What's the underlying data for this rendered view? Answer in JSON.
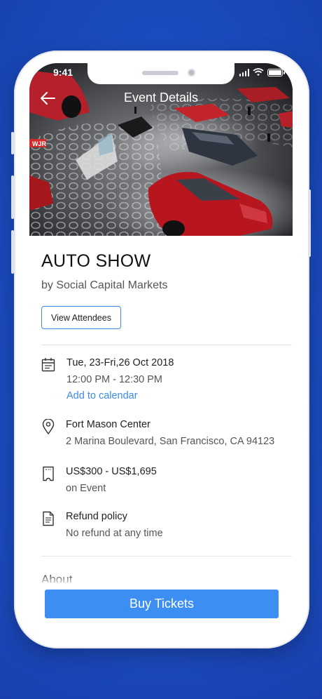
{
  "status_bar": {
    "time": "9:41"
  },
  "nav": {
    "title": "Event Details",
    "back_icon": "arrow-left-icon"
  },
  "colors": {
    "accent": "#3d8ef2",
    "link": "#3d8ae8",
    "background": "#1d4fc4"
  },
  "event": {
    "title": "AUTO SHOW",
    "organizer": "by Social Capital Markets",
    "view_attendees_label": "View Attendees"
  },
  "details": {
    "date": {
      "icon": "calendar-icon",
      "date_text": "Tue, 23-Fri,26 Oct 2018",
      "time_text": "12:00 PM - 12:30 PM",
      "add_calendar_label": "Add to calendar"
    },
    "location": {
      "icon": "map-pin-icon",
      "venue": "Fort Mason Center",
      "address": "2 Marina Boulevard, San Francisco, CA 94123"
    },
    "price": {
      "icon": "ticket-icon",
      "range": "US$300 - US$1,695",
      "note": "on Event"
    },
    "refund": {
      "icon": "document-icon",
      "title": "Refund policy",
      "text": "No refund at any time"
    }
  },
  "about": {
    "heading": "About"
  },
  "footer": {
    "buy_label": "Buy Tickets"
  }
}
